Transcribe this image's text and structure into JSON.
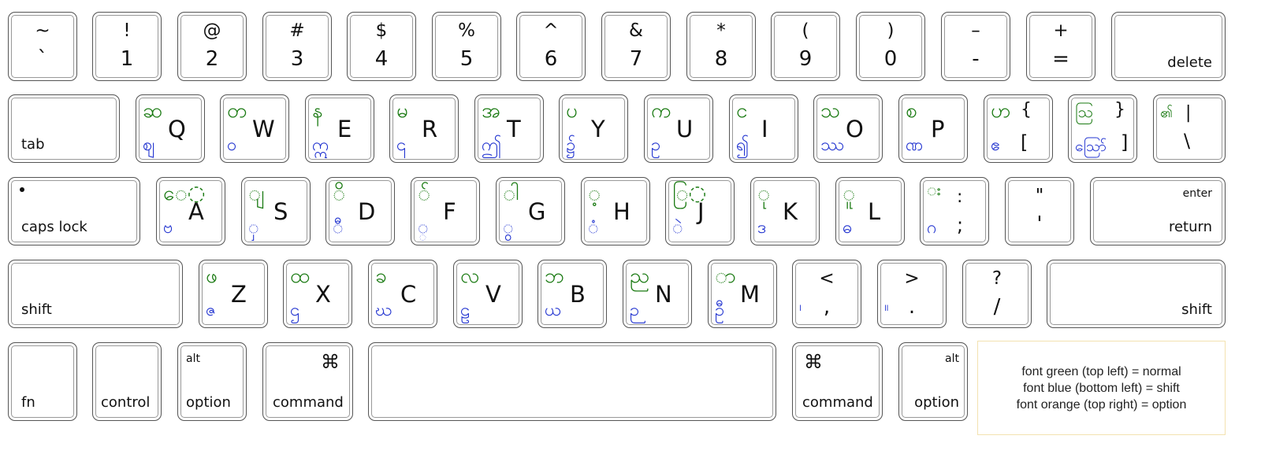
{
  "colors": {
    "normal": "#1a7a12",
    "shift": "#2234d0",
    "option": "#e08a00",
    "legend_border": "#f3e2b0"
  },
  "row1": [
    {
      "top": "~",
      "bottom": "`"
    },
    {
      "top": "!",
      "bottom": "1"
    },
    {
      "top": "@",
      "bottom": "2"
    },
    {
      "top": "#",
      "bottom": "3"
    },
    {
      "top": "$",
      "bottom": "4"
    },
    {
      "top": "%",
      "bottom": "5"
    },
    {
      "top": "^",
      "bottom": "6"
    },
    {
      "top": "&",
      "bottom": "7"
    },
    {
      "top": "*",
      "bottom": "8"
    },
    {
      "top": "(",
      "bottom": "9"
    },
    {
      "top": ")",
      "bottom": "0"
    },
    {
      "top": "–",
      "bottom": "-"
    },
    {
      "top": "+",
      "bottom": "="
    }
  ],
  "delete_label": "delete",
  "tab_label": "tab",
  "row2": [
    {
      "letter": "Q",
      "normal": "ဆ",
      "shift": "ဈ"
    },
    {
      "letter": "W",
      "normal": "တ",
      "shift": "ဝ"
    },
    {
      "letter": "E",
      "normal": "န",
      "shift": "ဣ"
    },
    {
      "letter": "R",
      "normal": "မ",
      "shift": "၎"
    },
    {
      "letter": "T",
      "normal": "အ",
      "shift": "ဤ"
    },
    {
      "letter": "Y",
      "normal": "ပ",
      "shift": "၌"
    },
    {
      "letter": "U",
      "normal": "က",
      "shift": "ဥ"
    },
    {
      "letter": "I",
      "normal": "င",
      "shift": "၍"
    },
    {
      "letter": "O",
      "normal": "သ",
      "shift": "ဿ"
    },
    {
      "letter": "P",
      "normal": "စ",
      "shift": "ဏ"
    }
  ],
  "bracket_left": {
    "top": "{",
    "bottom": "[",
    "normal": "ဟ",
    "shift": "ဧ"
  },
  "bracket_right": {
    "top": "}",
    "bottom": "]",
    "normal": "ဩ",
    "shift": "ဪ"
  },
  "backslash": {
    "top": "|",
    "bottom": "\\",
    "normal": "၏"
  },
  "caps_label": "caps lock",
  "row3": [
    {
      "letter": "A",
      "normal": "ေ◌",
      "shift": "ဗ"
    },
    {
      "letter": "S",
      "normal": "◌ျ",
      "shift": "◌ှ"
    },
    {
      "letter": "D",
      "normal": "◌ိ",
      "shift": "◌ီ"
    },
    {
      "letter": "F",
      "normal": "◌်",
      "shift": "◌္"
    },
    {
      "letter": "G",
      "normal": "◌ါ",
      "shift": "◌ွ"
    },
    {
      "letter": "H",
      "normal": "◌့",
      "shift": "◌ံ"
    },
    {
      "letter": "J",
      "normal": "ြ◌",
      "shift": "◌ဲ"
    },
    {
      "letter": "K",
      "normal": "◌ု",
      "shift": "ဒ"
    },
    {
      "letter": "L",
      "normal": "◌ူ",
      "shift": "ဓ"
    }
  ],
  "semicolon": {
    "top": ":",
    "bottom": ";",
    "normal": "◌း",
    "shift": "ဂ"
  },
  "quote": {
    "top": "\"",
    "bottom": "'"
  },
  "enter_label": "enter",
  "return_label": "return",
  "shift_label": "shift",
  "row4": [
    {
      "letter": "Z",
      "normal": "ဖ",
      "shift": "ဇ"
    },
    {
      "letter": "X",
      "normal": "ထ",
      "shift": "ဌ"
    },
    {
      "letter": "C",
      "normal": "ခ",
      "shift": "ဃ"
    },
    {
      "letter": "V",
      "normal": "လ",
      "shift": "ဠ"
    },
    {
      "letter": "B",
      "normal": "ဘ",
      "shift": "ယ"
    },
    {
      "letter": "N",
      "normal": "ည",
      "shift": "ဉ"
    },
    {
      "letter": "M",
      "normal": "◌ာ",
      "shift": "ဦ"
    }
  ],
  "comma": {
    "top": "<",
    "bottom": ",",
    "shift": "၊"
  },
  "period": {
    "top": ">",
    "bottom": ".",
    "shift": "။"
  },
  "slash": {
    "top": "?",
    "bottom": "/"
  },
  "bottom_row": {
    "fn": "fn",
    "control": "control",
    "alt": "alt",
    "option": "option",
    "command_symbol": "⌘",
    "command": "command"
  },
  "legend": [
    "font green (top left) = normal",
    "font blue (bottom left) = shift",
    "font orange (top right) = option"
  ]
}
